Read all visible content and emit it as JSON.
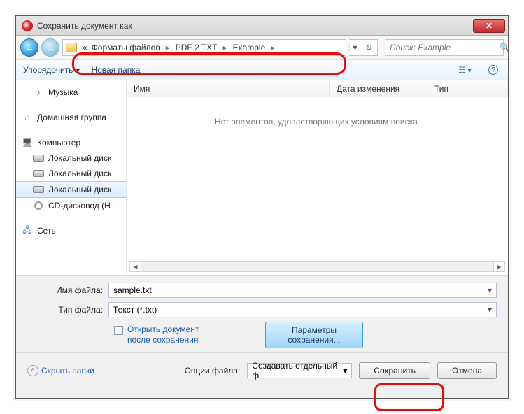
{
  "title": "Сохранить документ как",
  "breadcrumb": {
    "prefix": "«",
    "p1": "Форматы файлов",
    "p2": "PDF 2 TXT",
    "p3": "Example"
  },
  "search": {
    "placeholder": "Поиск: Example"
  },
  "toolbar": {
    "organize": "Упорядочить",
    "newfolder": "Новая папка"
  },
  "columns": {
    "name": "Имя",
    "date": "Дата изменения",
    "type": "Тип"
  },
  "empty": "Нет элементов, удовлетворяющих условиям поиска.",
  "tree": {
    "music": "Музыка",
    "homegroup": "Домашняя группа",
    "computer": "Компьютер",
    "disk1": "Локальный диск",
    "disk2": "Локальный диск",
    "disk3": "Локальный диск",
    "cd": "CD-дисковод (H",
    "network": "Сеть"
  },
  "form": {
    "filename_lbl": "Имя файла:",
    "filename_val": "sample.txt",
    "filetype_lbl": "Тип файла:",
    "filetype_val": "Текст (*.txt)",
    "open_after_l1": "Открыть документ",
    "open_after_l2": "после сохранения",
    "params_btn_l1": "Параметры",
    "params_btn_l2": "сохранения..."
  },
  "footer": {
    "hide": "Скрыть папки",
    "file_options_lbl": "Опции файла:",
    "file_options_val": "Создавать отдельный ф",
    "save": "Сохранить",
    "cancel": "Отмена"
  }
}
